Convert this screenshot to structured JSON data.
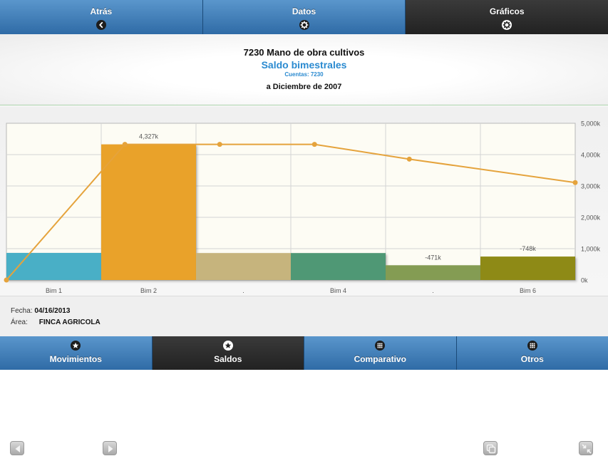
{
  "top_tabs": [
    {
      "label": "Atrás",
      "icon": "arrow-left-icon"
    },
    {
      "label": "Datos",
      "icon": "gear-icon"
    },
    {
      "label": "Gráficos",
      "icon": "gear-icon"
    }
  ],
  "header": {
    "title": "7230 Mano de obra cultivos",
    "subtitle": "Saldo bimestrales",
    "accounts": "Cuentas: 7230",
    "date": "a Diciembre de 2007"
  },
  "chart_data": {
    "type": "bar",
    "categories": [
      "Bim 1",
      "Bim 2",
      ".",
      "Bim 4",
      ".",
      "Bim 6"
    ],
    "values": [
      865,
      4327,
      860,
      860,
      -471,
      -748
    ],
    "data_labels": [
      "",
      "4,327k",
      "",
      "",
      "-471k",
      "-748k"
    ],
    "bar_colors": [
      "#4aafc6",
      "#e9a22b",
      "#c6b47d",
      "#4f9874",
      "#849c52",
      "#8e8a13"
    ],
    "line": {
      "color": "#e5a33c",
      "values": [
        0,
        4327,
        4327,
        4327,
        3856,
        3108
      ]
    },
    "y_ticks": [
      "0k",
      "1,000k",
      "2,000k",
      "3,000k",
      "4,000k",
      "5,000k"
    ],
    "ylim": [
      0,
      5000
    ],
    "grid": true,
    "y_axis_position": "right"
  },
  "info": {
    "fecha_label": "Fecha:",
    "fecha_value": "04/16/2013",
    "area_label": "Área:",
    "area_value": "FINCA AGRICOLA"
  },
  "bottom_tabs": [
    {
      "label": "Movimientos",
      "icon": "star-icon"
    },
    {
      "label": "Saldos",
      "icon": "star-icon"
    },
    {
      "label": "Comparativo",
      "icon": "grid-icon"
    },
    {
      "label": "Otros",
      "icon": "grid-icon"
    }
  ],
  "active_top_tab": "Gráficos",
  "active_bottom_tab": "Saldos"
}
